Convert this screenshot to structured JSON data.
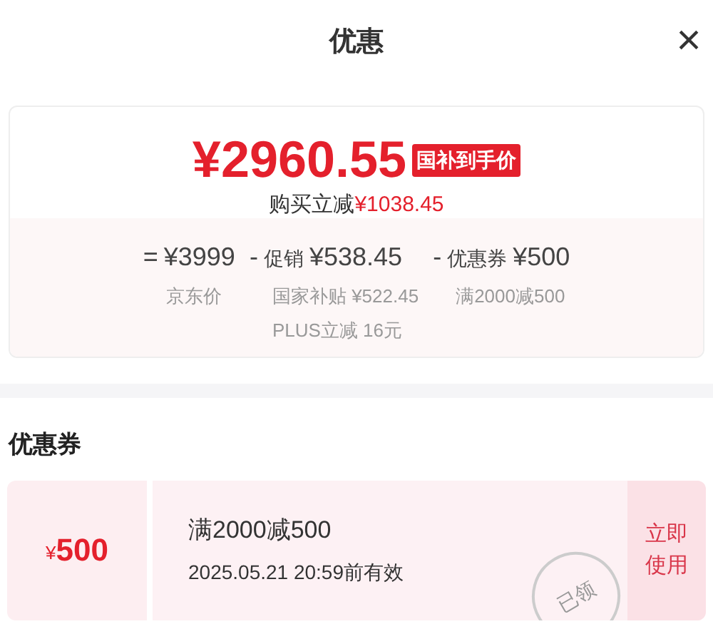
{
  "header": {
    "title": "优惠",
    "close": "×"
  },
  "price": {
    "amount": "¥2960.55",
    "badge": "国补到手价",
    "saving_label": "购买立减",
    "saving_amount": "¥1038.45"
  },
  "breakdown": [
    {
      "operator": "=",
      "amount": "¥3999",
      "notes": [
        "京东价"
      ]
    },
    {
      "operator": "-",
      "label": "促销",
      "amount": "¥538.45",
      "notes": [
        "国家补贴 ¥522.45",
        "PLUS立减 16元"
      ]
    },
    {
      "operator": "-",
      "label": "优惠券",
      "amount": "¥500",
      "notes": [
        "满2000减500"
      ]
    }
  ],
  "coupons_section": {
    "title": "优惠券",
    "coupons": [
      {
        "currency": "¥",
        "value": "500",
        "condition": "满2000减500",
        "validity": "2025.05.21 20:59前有效",
        "stamp": "已领",
        "action": "立即使用"
      }
    ]
  }
}
